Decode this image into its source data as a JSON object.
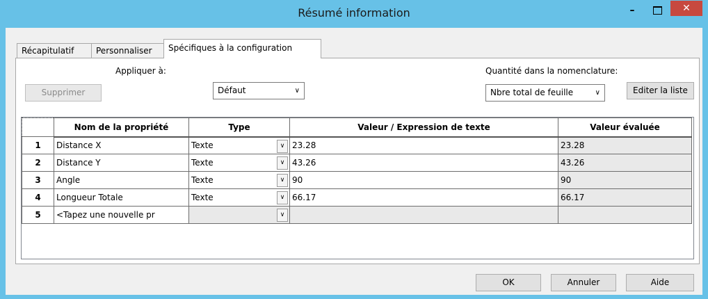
{
  "window": {
    "title": "Résumé information"
  },
  "tabs": [
    {
      "label": "Récapitulatif"
    },
    {
      "label": "Personnaliser"
    },
    {
      "label": "Spécifiques à la configuration"
    }
  ],
  "apply_to": {
    "label": "Appliquer à:",
    "delete_button": "Supprimer",
    "selected": "Défaut"
  },
  "bom": {
    "label": "Quantité dans la nomenclature:",
    "selected": "Nbre total de feuille",
    "edit_button": "Editer la liste"
  },
  "table": {
    "columns": [
      "Nom de la propriété",
      "Type",
      "Valeur / Expression de texte",
      "Valeur évaluée"
    ],
    "rows": [
      {
        "num": "1",
        "name": "Distance X",
        "type": "Texte",
        "value": "23.28",
        "evaluated": "23.28"
      },
      {
        "num": "2",
        "name": "Distance Y",
        "type": "Texte",
        "value": "43.26",
        "evaluated": "43.26"
      },
      {
        "num": "3",
        "name": "Angle",
        "type": "Texte",
        "value": "90",
        "evaluated": "90"
      },
      {
        "num": "4",
        "name": "Longueur Totale",
        "type": "Texte",
        "value": "66.17",
        "evaluated": "66.17"
      },
      {
        "num": "5",
        "name": "<Tapez une nouvelle pr",
        "type": "",
        "value": "",
        "evaluated": ""
      }
    ]
  },
  "footer": {
    "ok": "OK",
    "cancel": "Annuler",
    "help": "Aide"
  }
}
